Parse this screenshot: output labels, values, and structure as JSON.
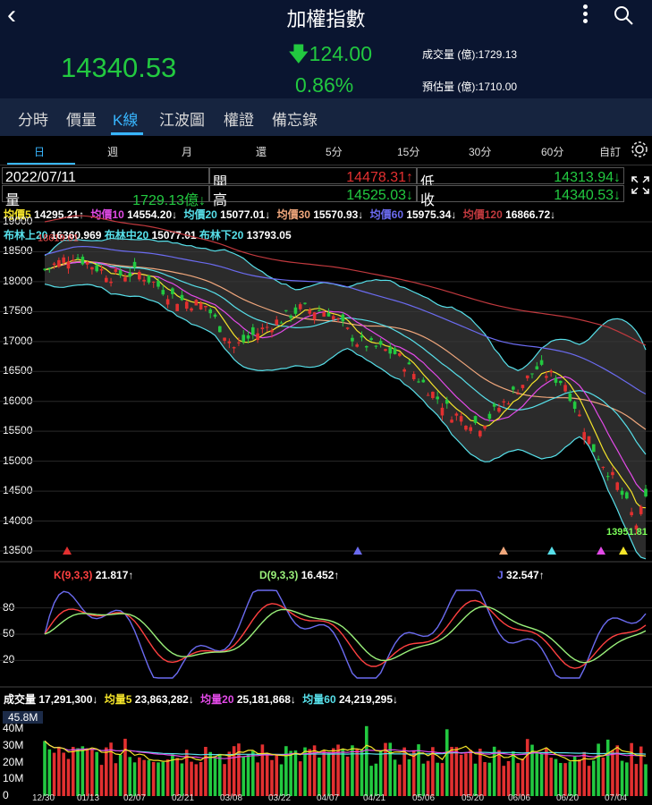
{
  "header": {
    "title": "加權指數",
    "price": "14340.53",
    "change": "124.00",
    "change_pct": "0.86%",
    "volume_label": "成交量 (億):1729.13",
    "est_volume_label": "預估量 (億):1710.00"
  },
  "tabs": [
    "分時",
    "價量",
    "K線",
    "江波圖",
    "權證",
    "備忘錄"
  ],
  "active_tab": "K線",
  "periods": [
    "日",
    "週",
    "月",
    "還",
    "5分",
    "15分",
    "30分",
    "60分",
    "自訂"
  ],
  "active_period": "日",
  "ohlc": {
    "date": "2022/07/11",
    "open_label": "開",
    "open": "14478.31↑",
    "low_label": "低",
    "low": "14313.94↓",
    "vol_label": "量",
    "vol": "1729.13億↓",
    "high_label": "高",
    "high": "14525.03↓",
    "close_label": "收",
    "close": "14340.53↓"
  },
  "ma": [
    {
      "label": "均價5",
      "value": "14295.21↑",
      "color": "#f5e52a"
    },
    {
      "label": "均價10",
      "value": "14554.20↓",
      "color": "#e34ae8"
    },
    {
      "label": "均價20",
      "value": "15077.01↓",
      "color": "#57e0ea"
    },
    {
      "label": "均價30",
      "value": "15570.93↓",
      "color": "#f0a77c"
    },
    {
      "label": "均價60",
      "value": "15975.34↓",
      "color": "#6b6bf0"
    },
    {
      "label": "均價120",
      "value": "16866.72↓",
      "color": "#c0393e"
    }
  ],
  "boll": {
    "upper_label": "布林上20",
    "upper": "16360.969",
    "mid_label": "布林中20",
    "mid": "15077.01",
    "lower_label": "布林下20",
    "lower": "13793.05"
  },
  "price_axis": [
    "19000",
    "18500",
    "18000",
    "17500",
    "17000",
    "16500",
    "16000",
    "15500",
    "15000",
    "14500",
    "14000",
    "13500"
  ],
  "annotations": {
    "high_mark": "18619.61",
    "low_mark": "13951.81"
  },
  "kdj": [
    {
      "label": "K(9,3,3)",
      "value": "21.817↑",
      "color": "#ff4040"
    },
    {
      "label": "D(9,3,3)",
      "value": "16.452↑",
      "color": "#9af07a"
    },
    {
      "label": "J",
      "value": "32.547↑",
      "color": "#6b6bf0"
    }
  ],
  "kdj_axis": [
    "80",
    "50",
    "20"
  ],
  "volume": [
    {
      "label": "成交量",
      "value": "17,291,300↓",
      "color": "#fff"
    },
    {
      "label": "均量5",
      "value": "23,863,282↓",
      "color": "#f5e52a"
    },
    {
      "label": "均量20",
      "value": "25,181,868↓",
      "color": "#e34ae8"
    },
    {
      "label": "均量60",
      "value": "24,219,295↓",
      "color": "#57e0ea"
    }
  ],
  "volume_axis": [
    "40M",
    "30M",
    "20M",
    "10M",
    "0"
  ],
  "volume_max_badge": "45.8M",
  "dates": [
    "12/30",
    "01/13",
    "02/07",
    "02/21",
    "03/08",
    "03/22",
    "04/07",
    "04/21",
    "05/06",
    "05/20",
    "06/06",
    "06/20",
    "07/04"
  ],
  "colors": {
    "up": "#e23030",
    "down": "#22c940",
    "accent": "#38b6ff"
  }
}
